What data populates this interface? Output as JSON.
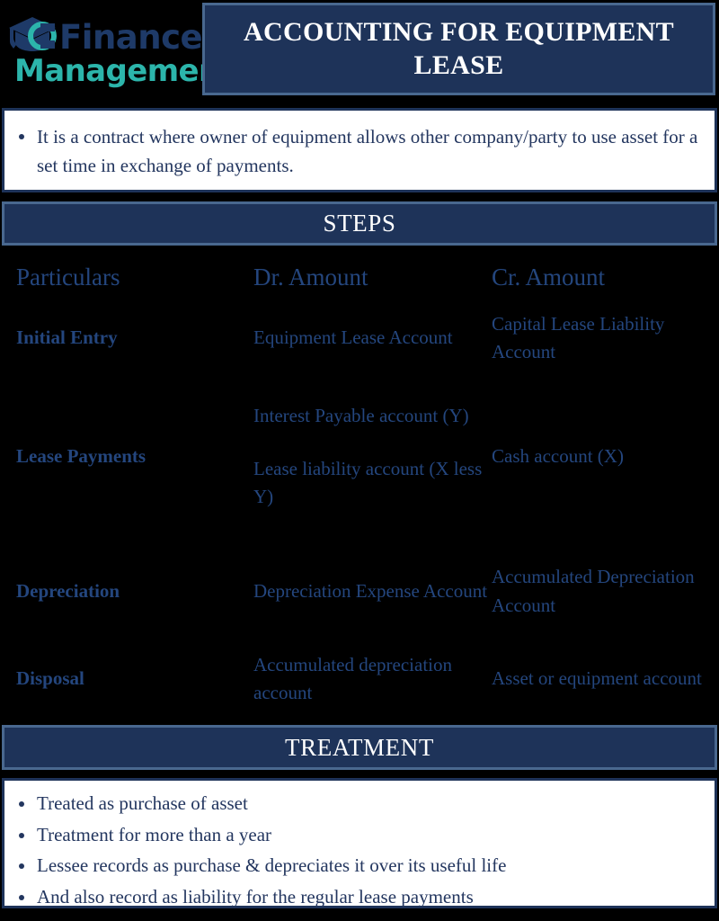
{
  "logo": {
    "icon": "graduation-cap-icon",
    "line1": "Finance",
    "line2": "Management"
  },
  "header": {
    "title": "ACCOUNTING FOR EQUIPMENT LEASE"
  },
  "intro": {
    "bullets": [
      "It is a contract where owner of equipment allows other company/party to use asset for a set time in exchange of payments."
    ]
  },
  "steps": {
    "band_label": "STEPS",
    "columns": [
      "Particulars",
      "Dr. Amount",
      "Cr. Amount"
    ],
    "rows": [
      {
        "particulars": "Initial Entry",
        "dr": [
          "Equipment Lease Account"
        ],
        "cr": [
          "Capital Lease Liability Account"
        ]
      },
      {
        "particulars": "Lease Payments",
        "dr": [
          "Interest Payable account (Y)",
          "Lease liability account (X less Y)"
        ],
        "cr": [
          "Cash account (X)"
        ]
      },
      {
        "particulars": "Depreciation",
        "dr": [
          "Depreciation Expense Account"
        ],
        "cr": [
          "Accumulated Depreciation Account"
        ]
      },
      {
        "particulars": "Disposal",
        "dr": [
          "Accumulated depreciation account"
        ],
        "cr": [
          "Asset or equipment account"
        ]
      }
    ]
  },
  "treatment": {
    "band_label": "TREATMENT",
    "bullets": [
      "Treated as purchase of asset",
      "Treatment for more than a year",
      "Lessee records as purchase & depreciates it over its useful life",
      "And also record as liability for the regular lease payments"
    ]
  },
  "colors": {
    "navy": "#1e3359",
    "navy_border": "#49688f",
    "text_navy": "#24467e",
    "teal": "#2cb5ab",
    "logo_navy": "#1e3a68",
    "white": "#ffffff",
    "background": "#000000"
  }
}
